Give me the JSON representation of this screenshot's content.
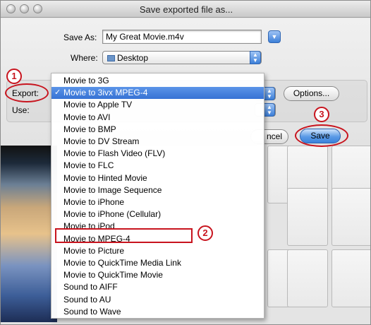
{
  "window": {
    "title": "Save exported file as..."
  },
  "form": {
    "save_as_label": "Save As:",
    "save_as_value": "My Great Movie.m4v",
    "where_label": "Where:",
    "where_value": "Desktop",
    "export_label": "Export:",
    "use_label": "Use:",
    "options_label": "Options...",
    "cancel_label": "ncel",
    "save_label": "Save"
  },
  "menu": {
    "items": [
      {
        "label": "Movie to 3G",
        "selected": false
      },
      {
        "label": "Movie to 3ivx MPEG-4",
        "selected": true
      },
      {
        "label": "Movie to Apple TV",
        "selected": false
      },
      {
        "label": "Movie to AVI",
        "selected": false
      },
      {
        "label": "Movie to BMP",
        "selected": false
      },
      {
        "label": "Movie to DV Stream",
        "selected": false
      },
      {
        "label": "Movie to Flash Video (FLV)",
        "selected": false
      },
      {
        "label": "Movie to FLC",
        "selected": false
      },
      {
        "label": "Movie to Hinted Movie",
        "selected": false
      },
      {
        "label": "Movie to Image Sequence",
        "selected": false
      },
      {
        "label": "Movie to iPhone",
        "selected": false
      },
      {
        "label": "Movie to iPhone (Cellular)",
        "selected": false
      },
      {
        "label": "Movie to iPod",
        "selected": false
      },
      {
        "label": "Movie to MPEG-4",
        "selected": false
      },
      {
        "label": "Movie to Picture",
        "selected": false
      },
      {
        "label": "Movie to QuickTime Media Link",
        "selected": false
      },
      {
        "label": "Movie to QuickTime Movie",
        "selected": false
      },
      {
        "label": "Sound to AIFF",
        "selected": false
      },
      {
        "label": "Sound to AU",
        "selected": false
      },
      {
        "label": "Sound to Wave",
        "selected": false
      }
    ]
  },
  "annotations": {
    "step1": "1",
    "step2": "2",
    "step3": "3",
    "color": "#c8141e"
  },
  "icons": {
    "check": "check-icon",
    "folder": "folder-icon",
    "disclosure": "disclosure-triangle-icon",
    "popup_arrows": "updown-arrows-icon"
  }
}
